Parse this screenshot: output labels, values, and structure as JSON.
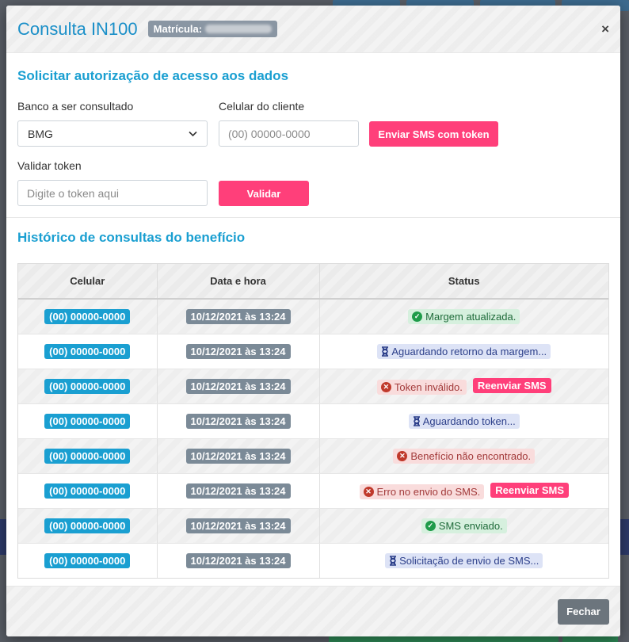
{
  "modal": {
    "title": "Consulta IN100",
    "matricula_label": "Matrícula:",
    "close_symbol": "×"
  },
  "auth": {
    "title": "Solicitar autorização de acesso aos dados",
    "bank_label": "Banco a ser consultado",
    "bank_value": "BMG",
    "phone_label": "Celular do cliente",
    "phone_placeholder": "(00) 00000-0000",
    "send_sms_label": "Enviar SMS com token",
    "token_label": "Validar token",
    "token_placeholder": "Digite o token aqui",
    "validate_label": "Validar"
  },
  "history": {
    "title": "Histórico de consultas do benefício",
    "columns": [
      "Celular",
      "Data e hora",
      "Status"
    ],
    "rows": [
      {
        "phone": "(00) 00000-0000",
        "datetime": "10/12/2021 às 13:24",
        "status": "Margem atualizada.",
        "kind": "success",
        "resend": ""
      },
      {
        "phone": "(00) 00000-0000",
        "datetime": "10/12/2021 às 13:24",
        "status": "Aguardando retorno da margem...",
        "kind": "info",
        "resend": ""
      },
      {
        "phone": "(00) 00000-0000",
        "datetime": "10/12/2021 às 13:24",
        "status": "Token inválido.",
        "kind": "danger",
        "resend": "Reenviar SMS"
      },
      {
        "phone": "(00) 00000-0000",
        "datetime": "10/12/2021 às 13:24",
        "status": "Aguardando token...",
        "kind": "info",
        "resend": ""
      },
      {
        "phone": "(00) 00000-0000",
        "datetime": "10/12/2021 às 13:24",
        "status": "Benefício não encontrado.",
        "kind": "danger",
        "resend": ""
      },
      {
        "phone": "(00) 00000-0000",
        "datetime": "10/12/2021 às 13:24",
        "status": "Erro no envio do SMS.",
        "kind": "danger",
        "resend": "Reenviar SMS"
      },
      {
        "phone": "(00) 00000-0000",
        "datetime": "10/12/2021 às 13:24",
        "status": "SMS enviado.",
        "kind": "success",
        "resend": ""
      },
      {
        "phone": "(00) 00000-0000",
        "datetime": "10/12/2021 às 13:24",
        "status": "Solicitação de envio de SMS...",
        "kind": "info",
        "resend": ""
      }
    ]
  },
  "footer": {
    "close_label": "Fechar"
  },
  "colors": {
    "accent": "#1a9fd1",
    "primary_button": "#ff3f7a",
    "secondary_button": "#6c757d"
  }
}
